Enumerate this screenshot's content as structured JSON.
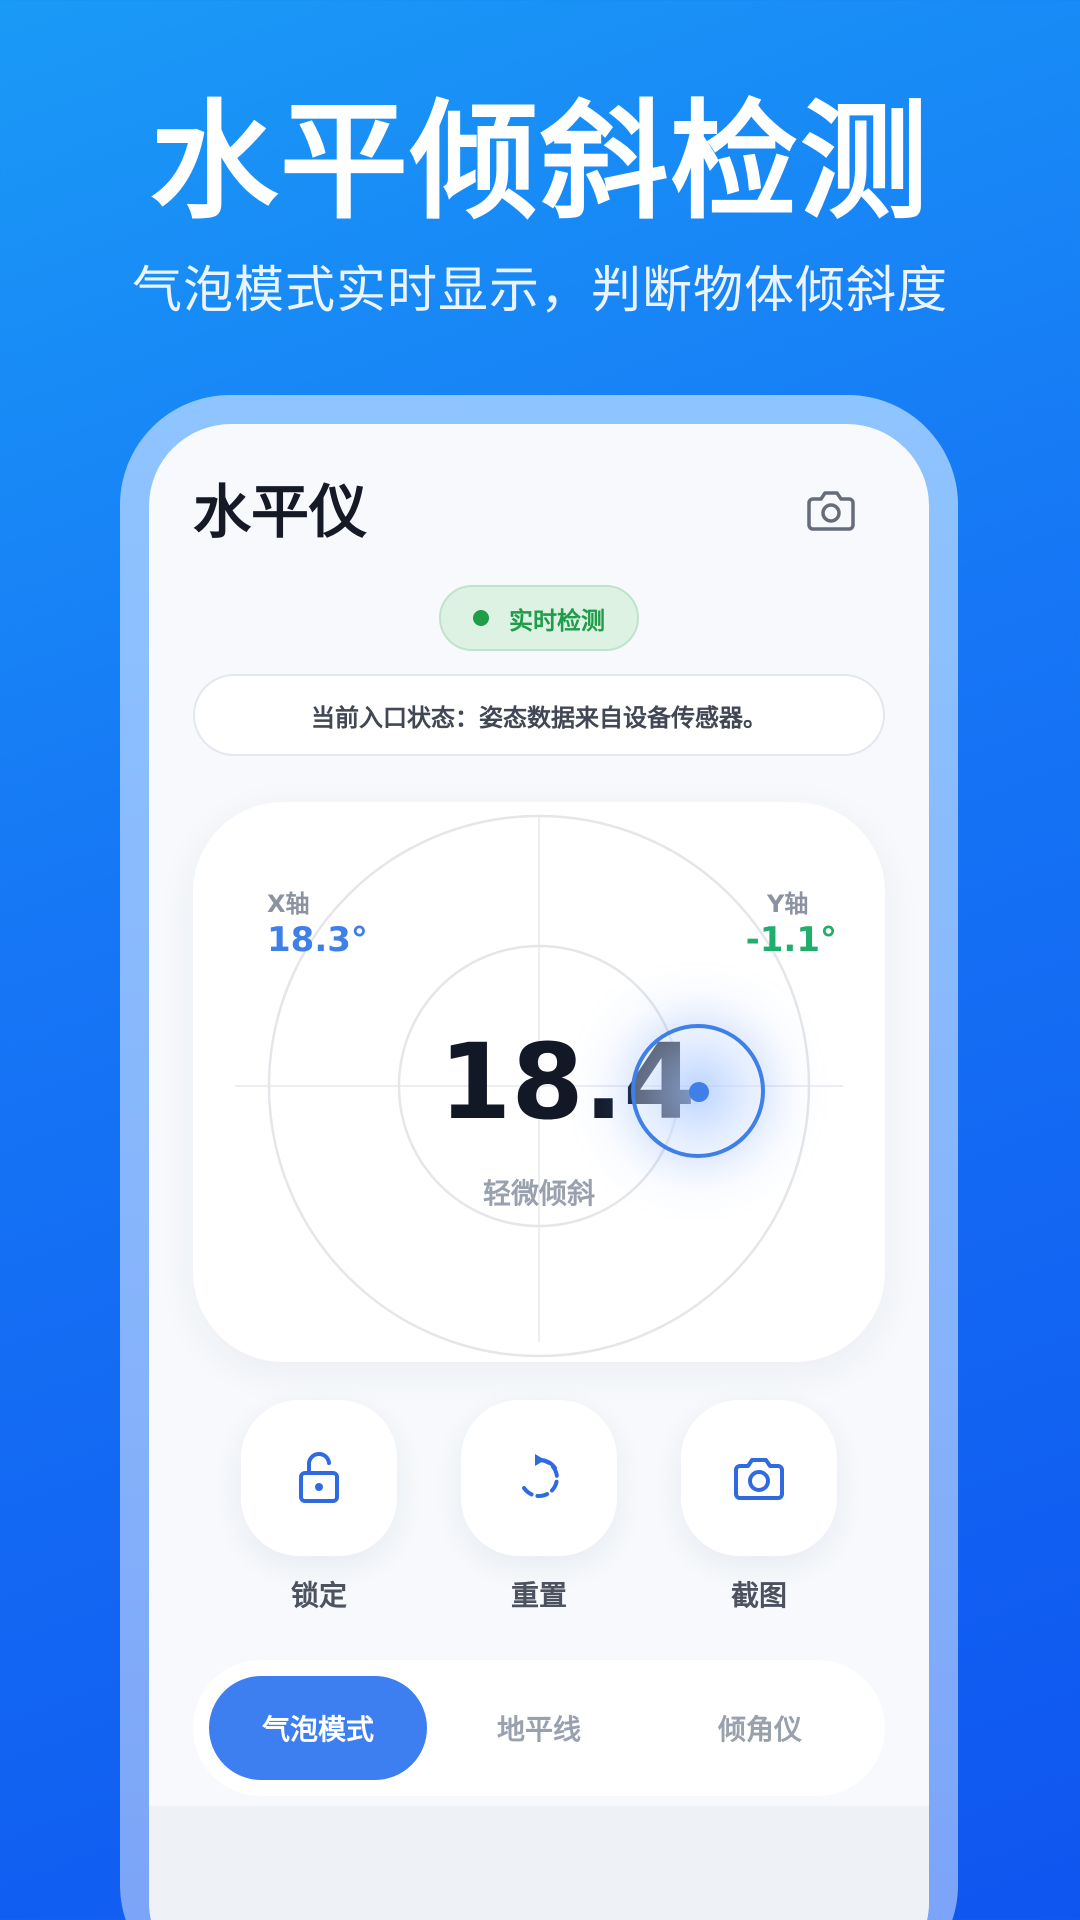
{
  "hero": {
    "title": "水平倾斜检测",
    "subtitle": "气泡模式实时显示，判断物体倾斜度"
  },
  "app": {
    "title": "水平仪",
    "header_icon": "camera-icon",
    "status_badge": "实时检测",
    "info_text": "当前入口状态：姿态数据来自设备传感器。"
  },
  "level": {
    "x_label": "X轴",
    "x_value": "18.3°",
    "y_label": "Y轴",
    "y_value": "-1.1°",
    "angle": "18.4",
    "status": "轻微倾斜"
  },
  "actions": [
    {
      "label": "锁定",
      "icon": "lock-icon"
    },
    {
      "label": "重置",
      "icon": "reset-icon"
    },
    {
      "label": "截图",
      "icon": "camera-icon"
    }
  ],
  "modes": [
    {
      "label": "气泡模式",
      "active": true
    },
    {
      "label": "地平线",
      "active": false
    },
    {
      "label": "倾角仪",
      "active": false
    }
  ],
  "colors": {
    "accent": "#3d7ff0",
    "x_value": "#3f7fe8",
    "y_value": "#1fae6c",
    "status_green": "#1f9d49"
  }
}
